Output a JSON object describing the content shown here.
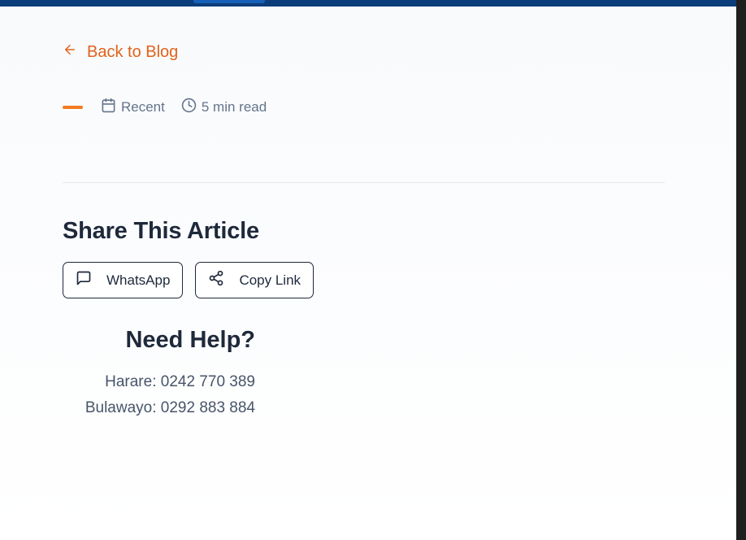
{
  "header": {
    "brand_color": "#0a3d7a",
    "active_tab_color": "#1760b8"
  },
  "back_link": {
    "label": "Back to Blog",
    "icon": "arrow-left-icon",
    "color": "#e2621b"
  },
  "meta": {
    "category_color": "#f47a20",
    "date_icon": "calendar-icon",
    "date": "Recent",
    "read_time_icon": "clock-icon",
    "read_time": "5 min read"
  },
  "share": {
    "title": "Share This Article",
    "buttons": [
      {
        "label": "WhatsApp",
        "icon": "message-square-icon"
      },
      {
        "label": "Copy Link",
        "icon": "share-icon"
      }
    ]
  },
  "help": {
    "title": "Need Help?",
    "lines": [
      "Harare: 0242 770 389",
      "Bulawayo: 0292 883 884"
    ]
  }
}
